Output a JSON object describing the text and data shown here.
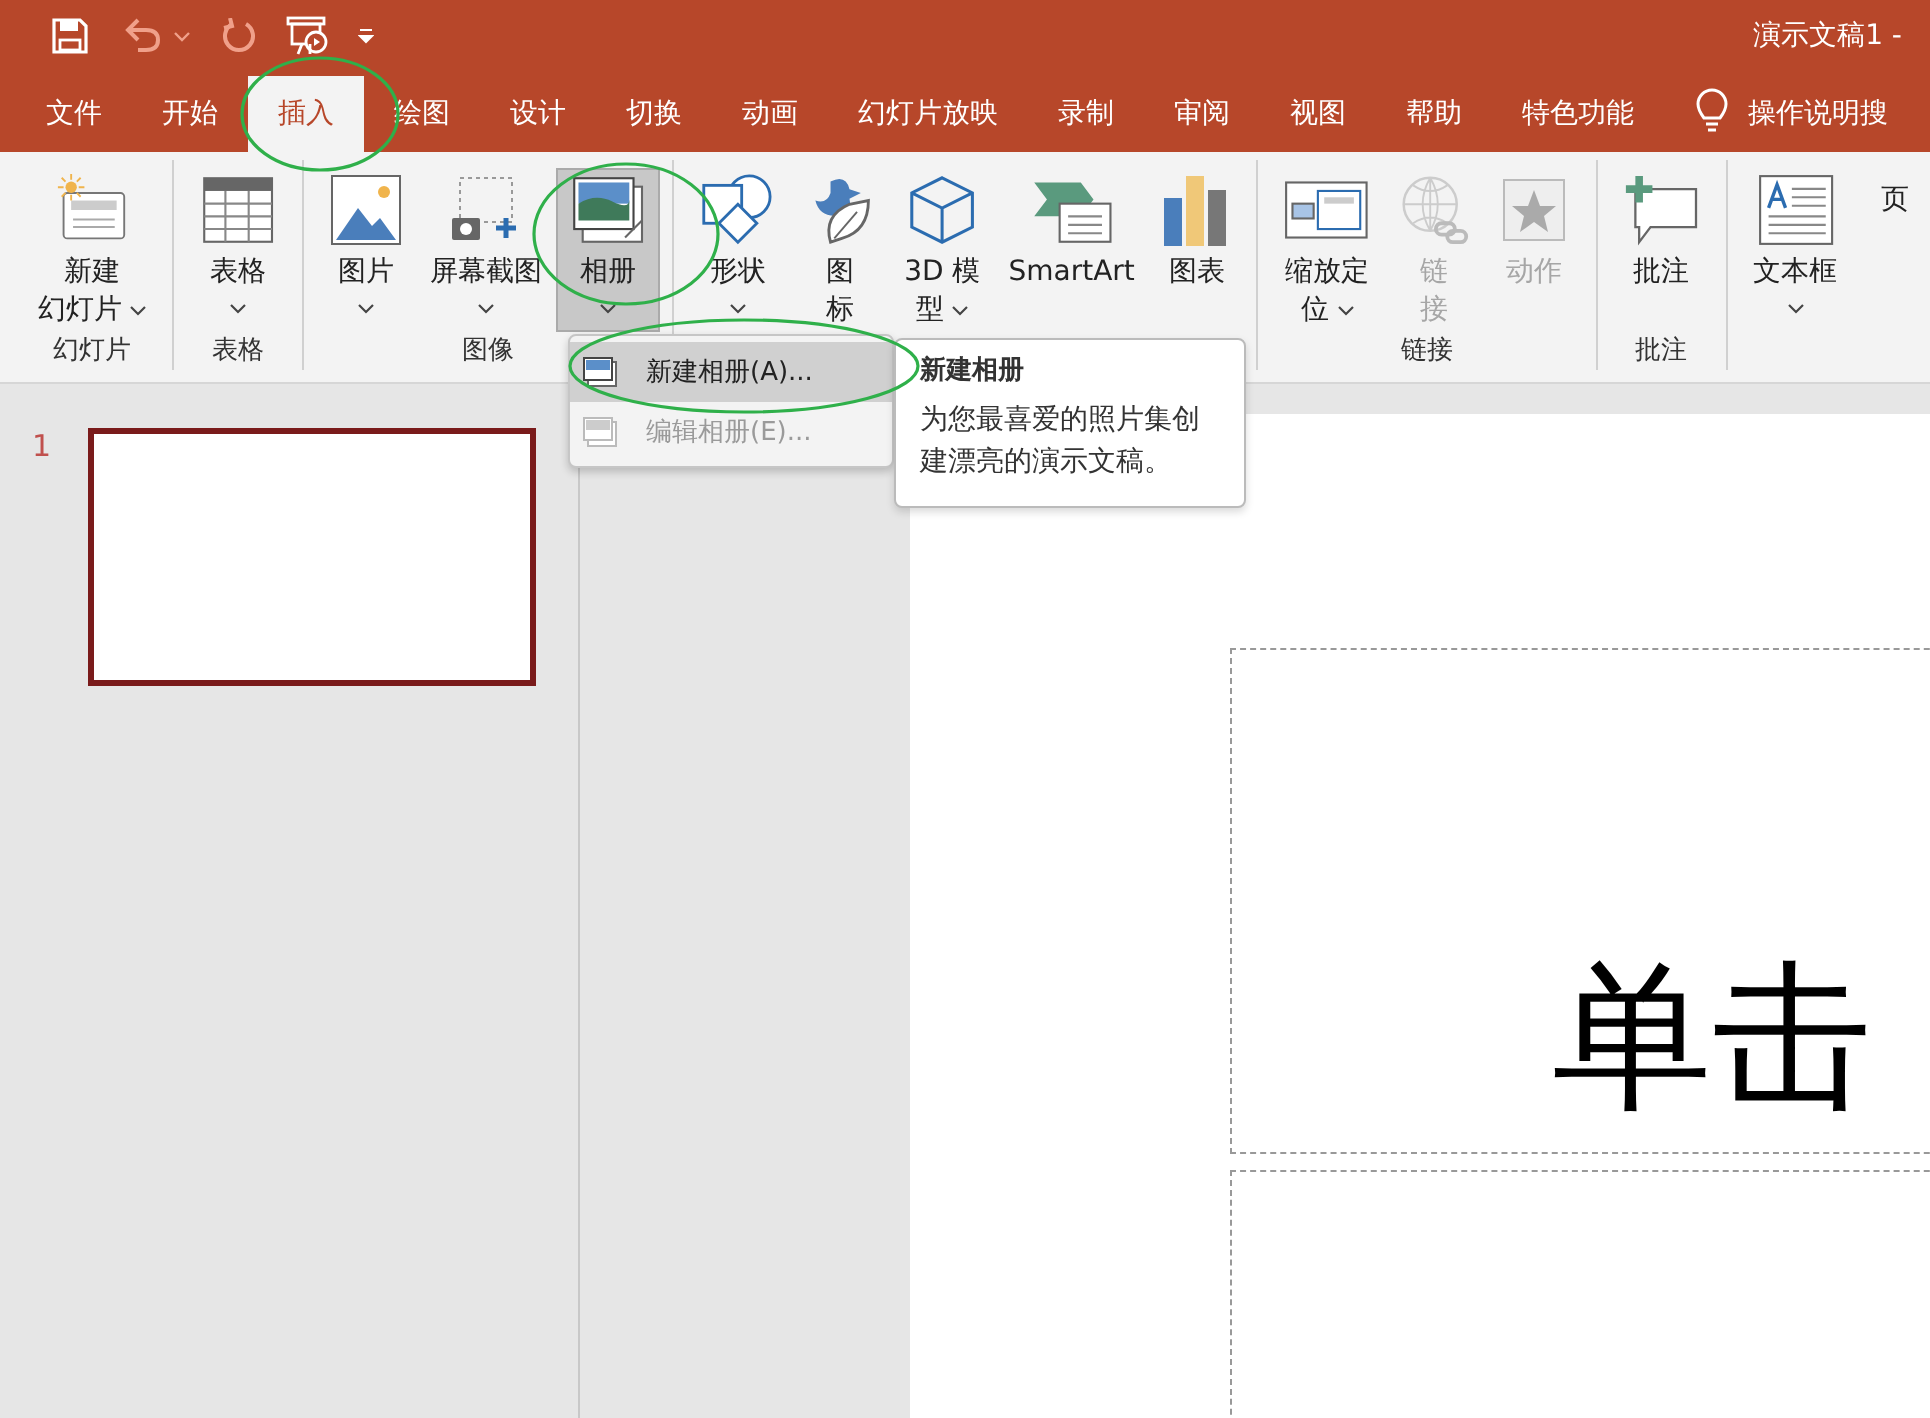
{
  "window": {
    "title": "演示文稿1 -"
  },
  "quick_access": [
    {
      "kind": "save"
    },
    {
      "kind": "undo",
      "caret": true
    },
    {
      "kind": "redo"
    },
    {
      "kind": "present"
    },
    {
      "kind": "customize"
    }
  ],
  "tabs": [
    {
      "label": "文件",
      "selected": false
    },
    {
      "label": "开始",
      "selected": false
    },
    {
      "label": "插入",
      "selected": true
    },
    {
      "label": "绘图",
      "selected": false
    },
    {
      "label": "设计",
      "selected": false
    },
    {
      "label": "切换",
      "selected": false
    },
    {
      "label": "动画",
      "selected": false
    },
    {
      "label": "幻灯片放映",
      "selected": false
    },
    {
      "label": "录制",
      "selected": false
    },
    {
      "label": "审阅",
      "selected": false
    },
    {
      "label": "视图",
      "selected": false
    },
    {
      "label": "帮助",
      "selected": false
    },
    {
      "label": "特色功能",
      "selected": false
    }
  ],
  "tell_me": {
    "label": "操作说明搜"
  },
  "ribbon_groups": [
    {
      "label": "幻灯片",
      "buttons": [
        {
          "kind": "slide",
          "lines": [
            "新建",
            "幻灯片"
          ],
          "caret": true,
          "disabled": false,
          "pressed": false
        }
      ]
    },
    {
      "label": "表格",
      "buttons": [
        {
          "kind": "table",
          "lines": [
            "表格"
          ],
          "caret": true,
          "disabled": false,
          "pressed": false
        }
      ]
    },
    {
      "label": "图像",
      "buttons": [
        {
          "kind": "picture",
          "lines": [
            "图片"
          ],
          "caret": true,
          "disabled": false,
          "pressed": false
        },
        {
          "kind": "screenshot",
          "lines": [
            "屏幕截图"
          ],
          "caret": true,
          "disabled": false,
          "pressed": false
        },
        {
          "kind": "album",
          "lines": [
            "相册"
          ],
          "caret": true,
          "disabled": false,
          "pressed": true
        }
      ]
    },
    {
      "buttons": [
        {
          "kind": "shapes",
          "lines": [
            "形状"
          ],
          "caret": true,
          "disabled": false,
          "pressed": false
        },
        {
          "kind": "icons",
          "lines": [
            "图",
            "标"
          ],
          "caret": false,
          "disabled": false,
          "pressed": false
        },
        {
          "kind": "model",
          "lines": [
            "3D 模",
            "型"
          ],
          "caret": true,
          "disabled": false,
          "pressed": false
        },
        {
          "kind": "smartart",
          "lines": [
            "SmartArt"
          ],
          "caret": false,
          "disabled": false,
          "pressed": false
        },
        {
          "kind": "chart",
          "lines": [
            "图表"
          ],
          "caret": false,
          "disabled": false,
          "pressed": false
        }
      ]
    },
    {
      "label": "链接",
      "buttons": [
        {
          "kind": "zoom",
          "lines": [
            "缩放定",
            "位"
          ],
          "caret": true,
          "disabled": false,
          "pressed": false
        },
        {
          "kind": "link",
          "lines": [
            "链",
            "接"
          ],
          "caret": false,
          "disabled": true,
          "pressed": false
        },
        {
          "kind": "action",
          "lines": [
            "动作"
          ],
          "caret": false,
          "disabled": true,
          "pressed": false
        }
      ]
    },
    {
      "label": "批注",
      "buttons": [
        {
          "kind": "comment",
          "lines": [
            "批注"
          ],
          "caret": false,
          "disabled": false,
          "pressed": false
        }
      ]
    },
    {
      "buttons": [
        {
          "kind": "textbox",
          "lines": [
            "文本框"
          ],
          "caret": true,
          "disabled": false,
          "pressed": false
        },
        {
          "kind": "page",
          "lines": [
            "页"
          ],
          "caret": false,
          "disabled": false,
          "pressed": false
        }
      ]
    }
  ],
  "album_menu": [
    {
      "label": "新建相册(A)...",
      "selected": true,
      "disabled": false
    },
    {
      "label": "编辑相册(E)...",
      "selected": false,
      "disabled": true
    }
  ],
  "tooltip": {
    "title": "新建相册",
    "text": "为您最喜爱的照片集创建漂亮的演示文稿。"
  },
  "slides": [
    {
      "number": "1",
      "selected": true
    }
  ],
  "slide": {
    "title": "单击"
  }
}
